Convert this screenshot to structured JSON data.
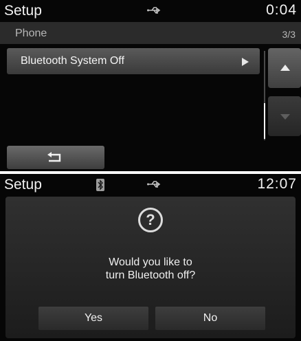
{
  "screen1": {
    "status_bar": {
      "title": "Setup",
      "time": "0:04",
      "usb_icon": "usb-icon"
    },
    "subheader": {
      "category": "Phone",
      "page_indicator": "3/3"
    },
    "list": [
      {
        "label": "Bluetooth System Off"
      }
    ],
    "icons": {
      "arrow": "chevron-right-icon",
      "up": "scroll-up-icon",
      "down": "scroll-down-icon",
      "back": "back-arrow-icon"
    }
  },
  "screen2": {
    "status_bar": {
      "title": "Setup",
      "time": "12:07",
      "bluetooth_icon": "bluetooth-icon",
      "usb_icon": "usb-icon"
    },
    "dialog": {
      "icon": "?",
      "message_line1": "Would you like to",
      "message_line2": "turn Bluetooth off?",
      "yes_label": "Yes",
      "no_label": "No"
    }
  },
  "colors": {
    "background": "#060606",
    "panel": "#2b2b2b",
    "text": "#f2f2f2"
  }
}
